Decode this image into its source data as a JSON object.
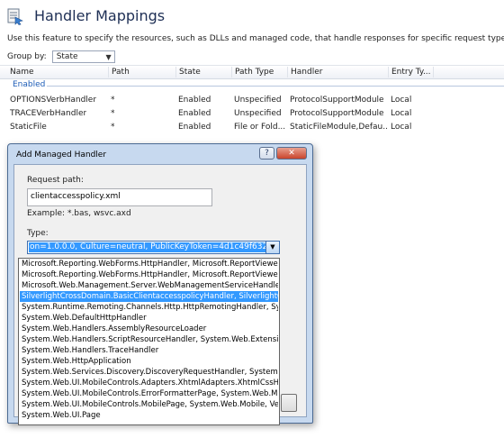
{
  "page": {
    "title": "Handler Mappings",
    "description": "Use this feature to specify the resources, such as DLLs and managed code, that handle responses for specific request types.",
    "group_by_label": "Group by:",
    "group_by_value": "State"
  },
  "grid": {
    "columns": [
      "Name",
      "Path",
      "State",
      "Path Type",
      "Handler",
      "Entry Ty..."
    ],
    "group_label": "Enabled",
    "rows": [
      {
        "name": "OPTIONSVerbHandler",
        "path": "*",
        "state": "Enabled",
        "path_type": "Unspecified",
        "handler": "ProtocolSupportModule",
        "entry_type": "Local"
      },
      {
        "name": "TRACEVerbHandler",
        "path": "*",
        "state": "Enabled",
        "path_type": "Unspecified",
        "handler": "ProtocolSupportModule",
        "entry_type": "Local"
      },
      {
        "name": "StaticFile",
        "path": "*",
        "state": "Enabled",
        "path_type": "File or Fold...",
        "handler": "StaticFileModule,Defau...",
        "entry_type": "Local"
      }
    ]
  },
  "dialog": {
    "title": "Add Managed Handler",
    "help_glyph": "?",
    "close_glyph": "✕",
    "request_path_label": "Request path:",
    "request_path_value": "clientaccesspolicy.xml",
    "example_text": "Example: *.bas, wsvc.axd",
    "type_label": "Type:",
    "type_value": "on=1.0.0.0, Culture=neutral, PublicKeyToken=4d1c49f632a38a3c",
    "type_options": [
      "Microsoft.Reporting.WebForms.HttpHandler, Microsoft.ReportViewe",
      "Microsoft.Reporting.WebForms.HttpHandler, Microsoft.ReportViewe",
      "Microsoft.Web.Management.Server.WebManagementServiceHandle",
      "SilverlightCrossDomain.BasicClientaccesspolicyHandler, SilverlightC",
      "System.Runtime.Remoting.Channels.Http.HttpRemotingHandler, Sys",
      "System.Web.DefaultHttpHandler",
      "System.Web.Handlers.AssemblyResourceLoader",
      "System.Web.Handlers.ScriptResourceHandler, System.Web.Extensio",
      "System.Web.Handlers.TraceHandler",
      "System.Web.HttpApplication",
      "System.Web.Services.Discovery.DiscoveryRequestHandler, System.W",
      "System.Web.UI.MobileControls.Adapters.XhtmlAdapters.XhtmlCssHa",
      "System.Web.UI.MobileControls.ErrorFormatterPage, System.Web.Mo",
      "System.Web.UI.MobileControls.MobilePage, System.Web.Mobile, Ve",
      "System.Web.UI.Page"
    ],
    "selected_option_index": 3
  }
}
